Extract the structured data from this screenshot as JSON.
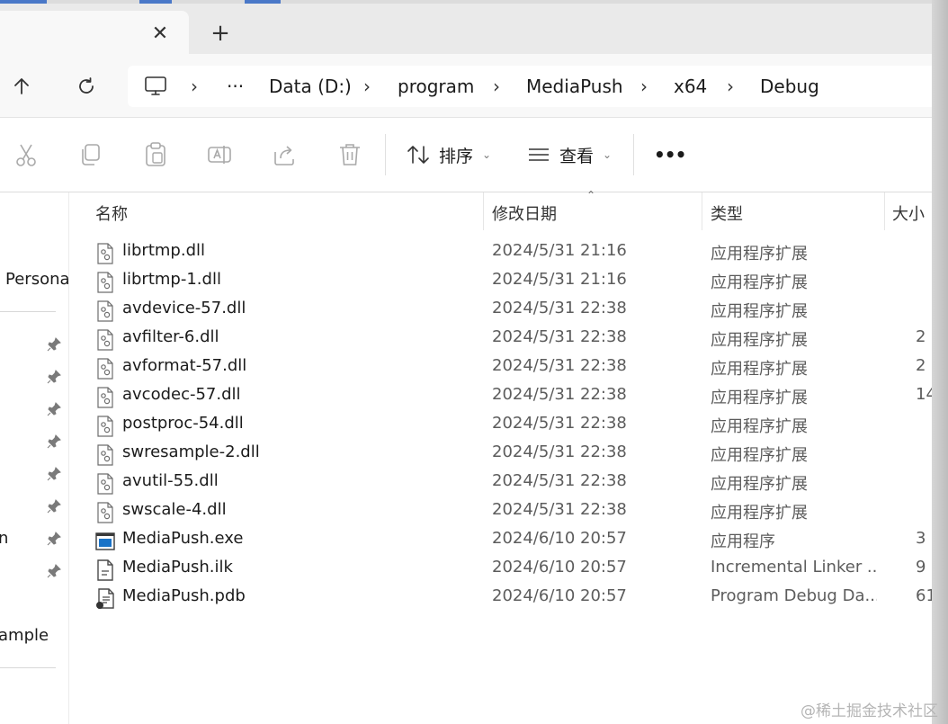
{
  "tab": {
    "close_glyph": "✕",
    "new_tab_glyph": "+"
  },
  "nav": {
    "up_icon": "arrow-up-icon",
    "refresh_icon": "refresh-icon"
  },
  "breadcrumb": {
    "more": "···",
    "items": [
      "Data (D:)",
      "program",
      "MediaPush",
      "x64",
      "Debug"
    ]
  },
  "toolbar": {
    "sort_label": "排序",
    "view_label": "查看",
    "more_label": "•••"
  },
  "sidebar": {
    "item_persona": "Persona",
    "item_n": "n",
    "item_ample": "ample"
  },
  "columns": {
    "name": "名称",
    "date": "修改日期",
    "type": "类型",
    "size": "大小"
  },
  "files": [
    {
      "name": "librtmp.dll",
      "date": "2024/5/31 21:16",
      "type": "应用程序扩展",
      "size": "",
      "icon": "dll"
    },
    {
      "name": "librtmp-1.dll",
      "date": "2024/5/31 21:16",
      "type": "应用程序扩展",
      "size": "",
      "icon": "dll"
    },
    {
      "name": "avdevice-57.dll",
      "date": "2024/5/31 22:38",
      "type": "应用程序扩展",
      "size": "",
      "icon": "dll"
    },
    {
      "name": "avfilter-6.dll",
      "date": "2024/5/31 22:38",
      "type": "应用程序扩展",
      "size": "2",
      "icon": "dll"
    },
    {
      "name": "avformat-57.dll",
      "date": "2024/5/31 22:38",
      "type": "应用程序扩展",
      "size": "2",
      "icon": "dll"
    },
    {
      "name": "avcodec-57.dll",
      "date": "2024/5/31 22:38",
      "type": "应用程序扩展",
      "size": "14",
      "icon": "dll"
    },
    {
      "name": "postproc-54.dll",
      "date": "2024/5/31 22:38",
      "type": "应用程序扩展",
      "size": "",
      "icon": "dll"
    },
    {
      "name": "swresample-2.dll",
      "date": "2024/5/31 22:38",
      "type": "应用程序扩展",
      "size": "",
      "icon": "dll"
    },
    {
      "name": "avutil-55.dll",
      "date": "2024/5/31 22:38",
      "type": "应用程序扩展",
      "size": "",
      "icon": "dll"
    },
    {
      "name": "swscale-4.dll",
      "date": "2024/5/31 22:38",
      "type": "应用程序扩展",
      "size": "",
      "icon": "dll"
    },
    {
      "name": "MediaPush.exe",
      "date": "2024/6/10 20:57",
      "type": "应用程序",
      "size": "3",
      "icon": "exe"
    },
    {
      "name": "MediaPush.ilk",
      "date": "2024/6/10 20:57",
      "type": "Incremental Linker ...",
      "size": "9",
      "icon": "ilk"
    },
    {
      "name": "MediaPush.pdb",
      "date": "2024/6/10 20:57",
      "type": "Program Debug Da...",
      "size": "61",
      "icon": "pdb"
    }
  ],
  "watermark": "@稀土掘金技术社区",
  "colors": {
    "accent": "#1a73c7",
    "text": "#1b1b1b",
    "muted": "#5c5c5c"
  }
}
